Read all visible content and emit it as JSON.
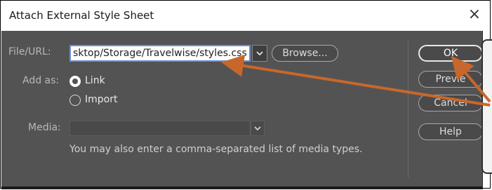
{
  "window": {
    "title": "Attach External Style Sheet",
    "close_glyph": "×"
  },
  "form": {
    "file_url_label": "File/URL:",
    "file_url_value": "sktop/Storage/Travelwise/styles.css",
    "browse_label": "Browse...",
    "add_as_label": "Add as:",
    "link_label": "Link",
    "link_selected": true,
    "import_label": "Import",
    "media_label": "Media:",
    "media_value": "",
    "hint_text": "You may also enter a comma-separated list of media types."
  },
  "buttons": {
    "ok_label": "OK",
    "preview_label": "Previe",
    "cancel_label": "Cancel",
    "help_label": "Help"
  },
  "icons": {
    "dropdown": "chevron-down-icon",
    "close": "close-icon"
  },
  "colors": {
    "panel_bg": "#535353",
    "annotation_arrow": "#c8672c",
    "input_focus_border": "#6a8fd6"
  }
}
